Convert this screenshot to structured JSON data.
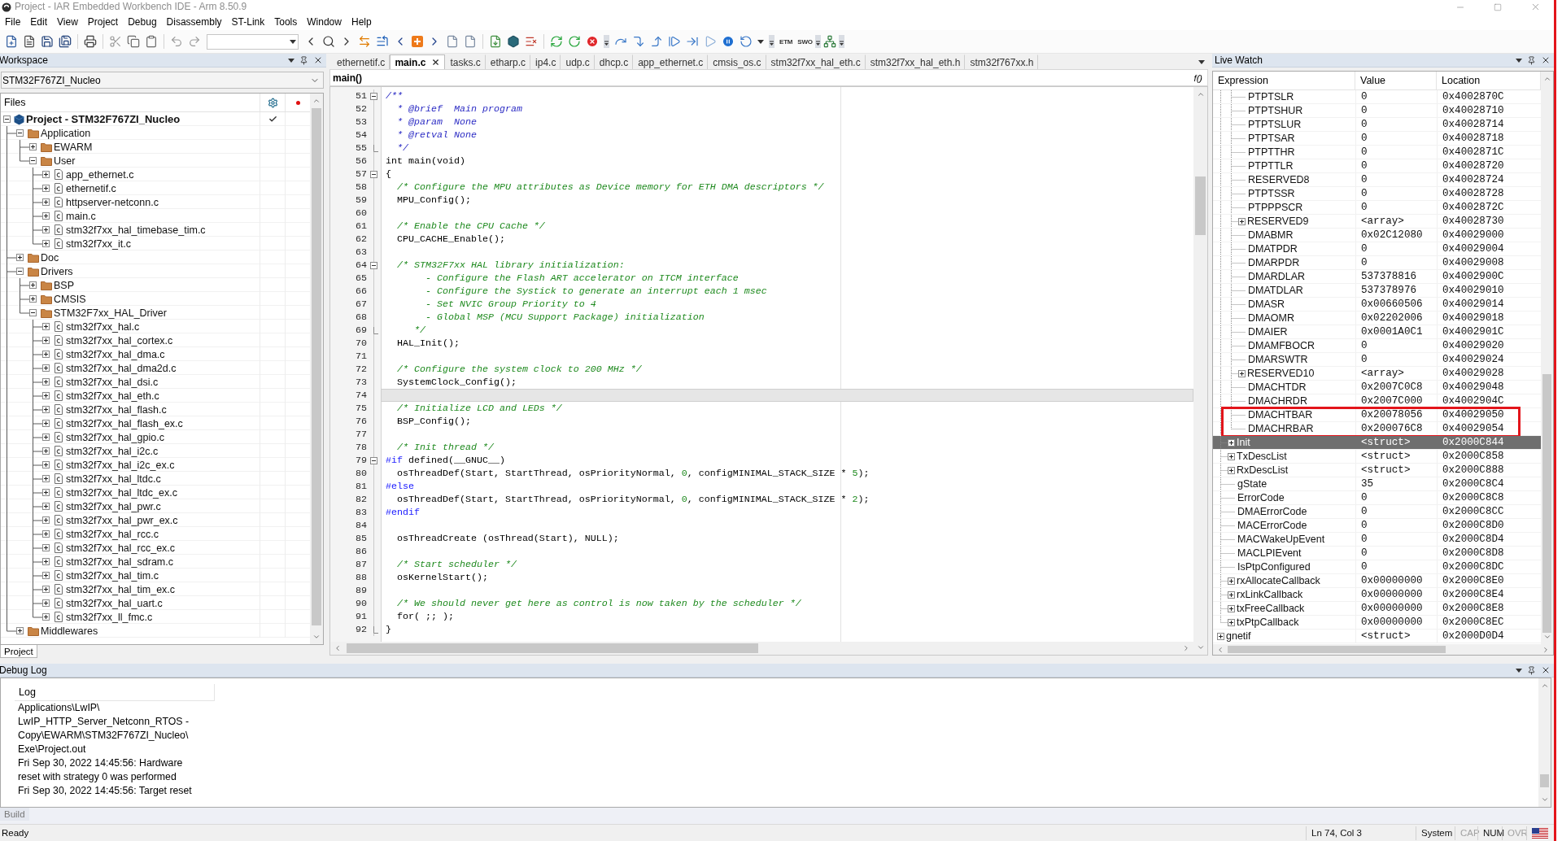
{
  "window": {
    "title": "Project - IAR Embedded Workbench IDE - Arm 8.50.9"
  },
  "menu": [
    "File",
    "Edit",
    "View",
    "Project",
    "Debug",
    "Disassembly",
    "ST-Link",
    "Tools",
    "Window",
    "Help"
  ],
  "toolbar": {
    "trace_buttons": [
      "ETM",
      "SWO"
    ]
  },
  "workspace": {
    "title": "Workspace",
    "configuration": "STM32F767ZI_Nucleo",
    "files_header": "Files",
    "project": {
      "name": "Project - STM32F767ZI_Nucleo",
      "expanded": true,
      "checked": true,
      "children": [
        {
          "name": "Application",
          "kind": "folder",
          "expanded": true,
          "children": [
            {
              "name": "EWARM",
              "kind": "folder",
              "expanded": false
            },
            {
              "name": "User",
              "kind": "folder",
              "expanded": true,
              "children": [
                {
                  "name": "app_ethernet.c",
                  "kind": "file",
                  "expanded": false
                },
                {
                  "name": "ethernetif.c",
                  "kind": "file",
                  "expanded": false
                },
                {
                  "name": "httpserver-netconn.c",
                  "kind": "file",
                  "expanded": false
                },
                {
                  "name": "main.c",
                  "kind": "file",
                  "expanded": false
                },
                {
                  "name": "stm32f7xx_hal_timebase_tim.c",
                  "kind": "file",
                  "expanded": false
                },
                {
                  "name": "stm32f7xx_it.c",
                  "kind": "file",
                  "expanded": false
                }
              ]
            }
          ]
        },
        {
          "name": "Doc",
          "kind": "folder",
          "expanded": false
        },
        {
          "name": "Drivers",
          "kind": "folder",
          "expanded": true,
          "children": [
            {
              "name": "BSP",
              "kind": "folder",
              "expanded": false
            },
            {
              "name": "CMSIS",
              "kind": "folder",
              "expanded": false
            },
            {
              "name": "STM32F7xx_HAL_Driver",
              "kind": "folder",
              "expanded": true,
              "children": [
                {
                  "name": "stm32f7xx_hal.c",
                  "kind": "file",
                  "expanded": false
                },
                {
                  "name": "stm32f7xx_hal_cortex.c",
                  "kind": "file",
                  "expanded": false
                },
                {
                  "name": "stm32f7xx_hal_dma.c",
                  "kind": "file",
                  "expanded": false
                },
                {
                  "name": "stm32f7xx_hal_dma2d.c",
                  "kind": "file",
                  "expanded": false
                },
                {
                  "name": "stm32f7xx_hal_dsi.c",
                  "kind": "file",
                  "expanded": false
                },
                {
                  "name": "stm32f7xx_hal_eth.c",
                  "kind": "file",
                  "expanded": false
                },
                {
                  "name": "stm32f7xx_hal_flash.c",
                  "kind": "file",
                  "expanded": false
                },
                {
                  "name": "stm32f7xx_hal_flash_ex.c",
                  "kind": "file",
                  "expanded": false
                },
                {
                  "name": "stm32f7xx_hal_gpio.c",
                  "kind": "file",
                  "expanded": false
                },
                {
                  "name": "stm32f7xx_hal_i2c.c",
                  "kind": "file",
                  "expanded": false
                },
                {
                  "name": "stm32f7xx_hal_i2c_ex.c",
                  "kind": "file",
                  "expanded": false
                },
                {
                  "name": "stm32f7xx_hal_ltdc.c",
                  "kind": "file",
                  "expanded": false
                },
                {
                  "name": "stm32f7xx_hal_ltdc_ex.c",
                  "kind": "file",
                  "expanded": false
                },
                {
                  "name": "stm32f7xx_hal_pwr.c",
                  "kind": "file",
                  "expanded": false
                },
                {
                  "name": "stm32f7xx_hal_pwr_ex.c",
                  "kind": "file",
                  "expanded": false
                },
                {
                  "name": "stm32f7xx_hal_rcc.c",
                  "kind": "file",
                  "expanded": false
                },
                {
                  "name": "stm32f7xx_hal_rcc_ex.c",
                  "kind": "file",
                  "expanded": false
                },
                {
                  "name": "stm32f7xx_hal_sdram.c",
                  "kind": "file",
                  "expanded": false
                },
                {
                  "name": "stm32f7xx_hal_tim.c",
                  "kind": "file",
                  "expanded": false
                },
                {
                  "name": "stm32f7xx_hal_tim_ex.c",
                  "kind": "file",
                  "expanded": false
                },
                {
                  "name": "stm32f7xx_hal_uart.c",
                  "kind": "file",
                  "expanded": false
                },
                {
                  "name": "stm32f7xx_ll_fmc.c",
                  "kind": "file",
                  "expanded": false
                }
              ]
            }
          ]
        },
        {
          "name": "Middlewares",
          "kind": "folder",
          "expanded": false
        }
      ]
    },
    "tabs": [
      {
        "label": "Project",
        "selected": true
      }
    ]
  },
  "editor": {
    "tabs": [
      {
        "label": "ethernetif.c",
        "selected": false
      },
      {
        "label": "main.c",
        "selected": true
      },
      {
        "label": "tasks.c",
        "selected": false
      },
      {
        "label": "etharp.c",
        "selected": false
      },
      {
        "label": "ip4.c",
        "selected": false
      },
      {
        "label": "udp.c",
        "selected": false
      },
      {
        "label": "dhcp.c",
        "selected": false
      },
      {
        "label": "app_ethernet.c",
        "selected": false
      },
      {
        "label": "cmsis_os.c",
        "selected": false
      },
      {
        "label": "stm32f7xx_hal_eth.c",
        "selected": false
      },
      {
        "label": "stm32f7xx_hal_eth.h",
        "selected": false
      },
      {
        "label": "stm32f767xx.h",
        "selected": false
      }
    ],
    "function": "main()",
    "function_button": "f()",
    "lines": [
      {
        "number": "51",
        "kind": "opener",
        "current": false,
        "segments": [
          {
            "kind": "doc",
            "text": "/**"
          }
        ]
      },
      {
        "number": "52",
        "kind": "code",
        "current": false,
        "segments": [
          {
            "kind": "doc",
            "text": "  * @brief  Main program"
          }
        ]
      },
      {
        "number": "53",
        "kind": "code",
        "current": false,
        "segments": [
          {
            "kind": "doc",
            "text": "  * @param  None"
          }
        ]
      },
      {
        "number": "54",
        "kind": "code",
        "current": false,
        "segments": [
          {
            "kind": "doc",
            "text": "  * @retval None"
          }
        ]
      },
      {
        "number": "55",
        "kind": "closer",
        "current": false,
        "segments": [
          {
            "kind": "doc",
            "text": "  */"
          }
        ]
      },
      {
        "number": "56",
        "kind": "code",
        "current": false,
        "segments": [
          {
            "kind": "plain",
            "text": "int main(void)"
          }
        ]
      },
      {
        "number": "57",
        "kind": "opener",
        "current": false,
        "segments": [
          {
            "kind": "plain",
            "text": "{"
          }
        ]
      },
      {
        "number": "58",
        "kind": "code",
        "current": false,
        "segments": [
          {
            "kind": "comment",
            "text": "  /* Configure the MPU attributes as Device memory for ETH DMA descriptors */"
          }
        ]
      },
      {
        "number": "59",
        "kind": "code",
        "current": false,
        "segments": [
          {
            "kind": "plain",
            "text": "  MPU_Config();"
          }
        ]
      },
      {
        "number": "60",
        "kind": "code",
        "current": false
      },
      {
        "number": "61",
        "kind": "code",
        "current": false,
        "segments": [
          {
            "kind": "comment",
            "text": "  /* Enable the CPU Cache */"
          }
        ]
      },
      {
        "number": "62",
        "kind": "code",
        "current": false,
        "segments": [
          {
            "kind": "plain",
            "text": "  CPU_CACHE_Enable();"
          }
        ]
      },
      {
        "number": "63",
        "kind": "code",
        "current": false
      },
      {
        "number": "64",
        "kind": "opener",
        "current": false,
        "segments": [
          {
            "kind": "comment",
            "text": "  /* STM32F7xx HAL library initialization:"
          }
        ]
      },
      {
        "number": "65",
        "kind": "code",
        "current": false,
        "segments": [
          {
            "kind": "comment",
            "text": "       - Configure the Flash ART accelerator on ITCM interface"
          }
        ]
      },
      {
        "number": "66",
        "kind": "code",
        "current": false,
        "segments": [
          {
            "kind": "comment",
            "text": "       - Configure the Systick to generate an interrupt each 1 msec"
          }
        ]
      },
      {
        "number": "67",
        "kind": "code",
        "current": false,
        "segments": [
          {
            "kind": "comment",
            "text": "       - Set NVIC Group Priority to 4"
          }
        ]
      },
      {
        "number": "68",
        "kind": "code",
        "current": false,
        "segments": [
          {
            "kind": "comment",
            "text": "       - Global MSP (MCU Support Package) initialization"
          }
        ]
      },
      {
        "number": "69",
        "kind": "closer",
        "current": false,
        "segments": [
          {
            "kind": "comment",
            "text": "     */"
          }
        ]
      },
      {
        "number": "70",
        "kind": "code",
        "current": false,
        "segments": [
          {
            "kind": "plain",
            "text": "  HAL_Init();"
          }
        ]
      },
      {
        "number": "71",
        "kind": "code",
        "current": false
      },
      {
        "number": "72",
        "kind": "code",
        "current": false,
        "segments": [
          {
            "kind": "comment",
            "text": "  /* Configure the system clock to 200 MHz */"
          }
        ]
      },
      {
        "number": "73",
        "kind": "code",
        "current": false,
        "segments": [
          {
            "kind": "plain",
            "text": "  SystemClock_Config();"
          }
        ]
      },
      {
        "number": "74",
        "kind": "code",
        "current": true
      },
      {
        "number": "75",
        "kind": "code",
        "current": false,
        "segments": [
          {
            "kind": "comment",
            "text": "  /* Initialize LCD and LEDs */"
          }
        ]
      },
      {
        "number": "76",
        "kind": "code",
        "current": false,
        "segments": [
          {
            "kind": "plain",
            "text": "  BSP_Config();"
          }
        ]
      },
      {
        "number": "77",
        "kind": "code",
        "current": false
      },
      {
        "number": "78",
        "kind": "code",
        "current": false,
        "segments": [
          {
            "kind": "comment",
            "text": "  /* Init thread */"
          }
        ]
      },
      {
        "number": "79",
        "kind": "opener",
        "current": false,
        "segments": [
          {
            "kind": "preproc",
            "text": "#if"
          },
          {
            "kind": "plain",
            "text": " defined(__GNUC__)"
          }
        ]
      },
      {
        "number": "80",
        "kind": "code",
        "current": false,
        "segments": [
          {
            "kind": "plain",
            "text": "  osThreadDef(Start, StartThread, osPriorityNormal, "
          },
          {
            "kind": "number",
            "text": "0"
          },
          {
            "kind": "plain",
            "text": ", configMINIMAL_STACK_SIZE * "
          },
          {
            "kind": "number",
            "text": "5"
          },
          {
            "kind": "plain",
            "text": ");"
          }
        ]
      },
      {
        "number": "81",
        "kind": "code",
        "current": false,
        "segments": [
          {
            "kind": "preproc",
            "text": "#else"
          }
        ]
      },
      {
        "number": "82",
        "kind": "code",
        "current": false,
        "segments": [
          {
            "kind": "plain",
            "text": "  osThreadDef(Start, StartThread, osPriorityNormal, "
          },
          {
            "kind": "number",
            "text": "0"
          },
          {
            "kind": "plain",
            "text": ", configMINIMAL_STACK_SIZE * "
          },
          {
            "kind": "number",
            "text": "2"
          },
          {
            "kind": "plain",
            "text": ");"
          }
        ]
      },
      {
        "number": "83",
        "kind": "code",
        "current": false,
        "segments": [
          {
            "kind": "preproc",
            "text": "#endif"
          }
        ]
      },
      {
        "number": "84",
        "kind": "code",
        "current": false
      },
      {
        "number": "85",
        "kind": "code",
        "current": false,
        "segments": [
          {
            "kind": "plain",
            "text": "  osThreadCreate (osThread(Start), NULL);"
          }
        ]
      },
      {
        "number": "86",
        "kind": "code",
        "current": false
      },
      {
        "number": "87",
        "kind": "code",
        "current": false,
        "segments": [
          {
            "kind": "comment",
            "text": "  /* Start scheduler */"
          }
        ]
      },
      {
        "number": "88",
        "kind": "code",
        "current": false,
        "segments": [
          {
            "kind": "plain",
            "text": "  osKernelStart();"
          }
        ]
      },
      {
        "number": "89",
        "kind": "code",
        "current": false
      },
      {
        "number": "90",
        "kind": "code",
        "current": false,
        "segments": [
          {
            "kind": "comment",
            "text": "  /* We should never get here as control is now taken by the scheduler */"
          }
        ]
      },
      {
        "number": "91",
        "kind": "code",
        "current": false,
        "segments": [
          {
            "kind": "plain",
            "text": "  for( ;; );"
          }
        ]
      },
      {
        "number": "92",
        "kind": "closer",
        "current": false,
        "segments": [
          {
            "kind": "plain",
            "text": "}"
          }
        ]
      }
    ]
  },
  "live_watch": {
    "title": "Live Watch",
    "columns": [
      "Expression",
      "Value",
      "Location"
    ],
    "rows": [
      {
        "children": [
          {
            "children": [
              {
                "expression": "PTPTSLR",
                "value": "0",
                "location": "0x4002870C",
                "selected": false,
                "highlighted": false
              },
              {
                "expression": "PTPTSHUR",
                "value": "0",
                "location": "0x40028710",
                "selected": false,
                "highlighted": false
              },
              {
                "expression": "PTPTSLUR",
                "value": "0",
                "location": "0x40028714",
                "selected": false,
                "highlighted": false
              },
              {
                "expression": "PTPTSAR",
                "value": "0",
                "location": "0x40028718",
                "selected": false,
                "highlighted": false
              },
              {
                "expression": "PTPTTHR",
                "value": "0",
                "location": "0x4002871C",
                "selected": false,
                "highlighted": false
              },
              {
                "expression": "PTPTTLR",
                "value": "0",
                "location": "0x40028720",
                "selected": false,
                "highlighted": false
              },
              {
                "expression": "RESERVED8",
                "value": "0",
                "location": "0x40028724",
                "selected": false,
                "highlighted": false
              },
              {
                "expression": "PTPTSSR",
                "value": "0",
                "location": "0x40028728",
                "selected": false,
                "highlighted": false
              },
              {
                "expression": "PTPPPSCR",
                "value": "0",
                "location": "0x4002872C",
                "selected": false,
                "highlighted": false
              },
              {
                "expression": "RESERVED9",
                "value": "<array>",
                "location": "0x40028730",
                "expanded": false,
                "selected": false,
                "highlighted": false
              },
              {
                "expression": "DMABMR",
                "value": "0x02C12080",
                "location": "0x40029000",
                "selected": false,
                "highlighted": false
              },
              {
                "expression": "DMATPDR",
                "value": "0",
                "location": "0x40029004",
                "selected": false,
                "highlighted": false
              },
              {
                "expression": "DMARPDR",
                "value": "0",
                "location": "0x40029008",
                "selected": false,
                "highlighted": false
              },
              {
                "expression": "DMARDLAR",
                "value": "537378816",
                "location": "0x4002900C",
                "selected": false,
                "highlighted": false
              },
              {
                "expression": "DMATDLAR",
                "value": "537378976",
                "location": "0x40029010",
                "selected": false,
                "highlighted": false
              },
              {
                "expression": "DMASR",
                "value": "0x00660506",
                "location": "0x40029014",
                "selected": false,
                "highlighted": false
              },
              {
                "expression": "DMAOMR",
                "value": "0x02202006",
                "location": "0x40029018",
                "selected": false,
                "highlighted": false
              },
              {
                "expression": "DMAIER",
                "value": "0x0001A0C1",
                "location": "0x4002901C",
                "selected": false,
                "highlighted": false
              },
              {
                "expression": "DMAMFBOCR",
                "value": "0",
                "location": "0x40029020",
                "selected": false,
                "highlighted": false
              },
              {
                "expression": "DMARSWTR",
                "value": "0",
                "location": "0x40029024",
                "selected": false,
                "highlighted": false
              },
              {
                "expression": "RESERVED10",
                "value": "<array>",
                "location": "0x40029028",
                "expanded": false,
                "selected": false,
                "highlighted": false
              },
              {
                "expression": "DMACHTDR",
                "value": "0x2007C0C8",
                "location": "0x40029048",
                "selected": false,
                "highlighted": false
              },
              {
                "expression": "DMACHRDR",
                "value": "0x2007C000",
                "location": "0x4002904C",
                "selected": false,
                "highlighted": false
              },
              {
                "expression": "DMACHTBAR",
                "value": "0x20078056",
                "location": "0x40029050",
                "selected": false,
                "highlighted": true
              },
              {
                "expression": "DMACHRBAR",
                "value": "0x200076C8",
                "location": "0x40029054",
                "selected": false,
                "highlighted": true
              }
            ]
          },
          {
            "expression": "Init",
            "value": "<struct>",
            "location": "0x2000C844",
            "expanded": false,
            "selected": true,
            "highlighted": false
          },
          {
            "expression": "TxDescList",
            "value": "<struct>",
            "location": "0x2000C858",
            "expanded": false,
            "selected": false,
            "highlighted": false
          },
          {
            "expression": "RxDescList",
            "value": "<struct>",
            "location": "0x2000C888",
            "expanded": false,
            "selected": false,
            "highlighted": false
          },
          {
            "expression": "gState",
            "value": "35",
            "location": "0x2000C8C4",
            "selected": false,
            "highlighted": false
          },
          {
            "expression": "ErrorCode",
            "value": "0",
            "location": "0x2000C8C8",
            "selected": false,
            "highlighted": false
          },
          {
            "expression": "DMAErrorCode",
            "value": "0",
            "location": "0x2000C8CC",
            "selected": false,
            "highlighted": false
          },
          {
            "expression": "MACErrorCode",
            "value": "0",
            "location": "0x2000C8D0",
            "selected": false,
            "highlighted": false
          },
          {
            "expression": "MACWakeUpEvent",
            "value": "0",
            "location": "0x2000C8D4",
            "selected": false,
            "highlighted": false
          },
          {
            "expression": "MACLPIEvent",
            "value": "0",
            "location": "0x2000C8D8",
            "selected": false,
            "highlighted": false
          },
          {
            "expression": "IsPtpConfigured",
            "value": "0",
            "location": "0x2000C8DC",
            "selected": false,
            "highlighted": false
          },
          {
            "expression": "rxAllocateCallback",
            "value": "0x00000000",
            "location": "0x2000C8E0",
            "expanded": false,
            "selected": false,
            "highlighted": false
          },
          {
            "expression": "rxLinkCallback",
            "value": "0x00000000",
            "location": "0x2000C8E4",
            "expanded": false,
            "selected": false,
            "highlighted": false
          },
          {
            "expression": "txFreeCallback",
            "value": "0x00000000",
            "location": "0x2000C8E8",
            "expanded": false,
            "selected": false,
            "highlighted": false
          },
          {
            "expression": "txPtpCallback",
            "value": "0x00000000",
            "location": "0x2000C8EC",
            "expanded": false,
            "selected": false,
            "highlighted": false
          }
        ]
      },
      {
        "expression": "gnetif",
        "value": "<struct>",
        "location": "0x2000D0D4",
        "expanded": false,
        "selected": false,
        "highlighted": false
      }
    ]
  },
  "debug_log": {
    "title": "Debug Log",
    "column": "Log",
    "entries": [
      "Applications\\LwIP\\\nLwIP_HTTP_Server_Netconn_RTOS -\nCopy\\EWARM\\STM32F767ZI_Nucleo\\\nExe\\Project.out",
      "Fri Sep 30, 2022 14:45:56: Hardware\nreset with strategy 0 was performed",
      "Fri Sep 30, 2022 14:45:56: Target reset"
    ],
    "tabs": [
      {
        "label": "Build",
        "selected": false
      }
    ]
  },
  "status_bar": {
    "message": "Ready",
    "position": "Ln 74, Col 3",
    "mode": "System",
    "indicators": [
      {
        "label": "CAP",
        "on": false
      },
      {
        "label": "NUM",
        "on": true
      },
      {
        "label": "OVR",
        "on": false
      }
    ]
  }
}
